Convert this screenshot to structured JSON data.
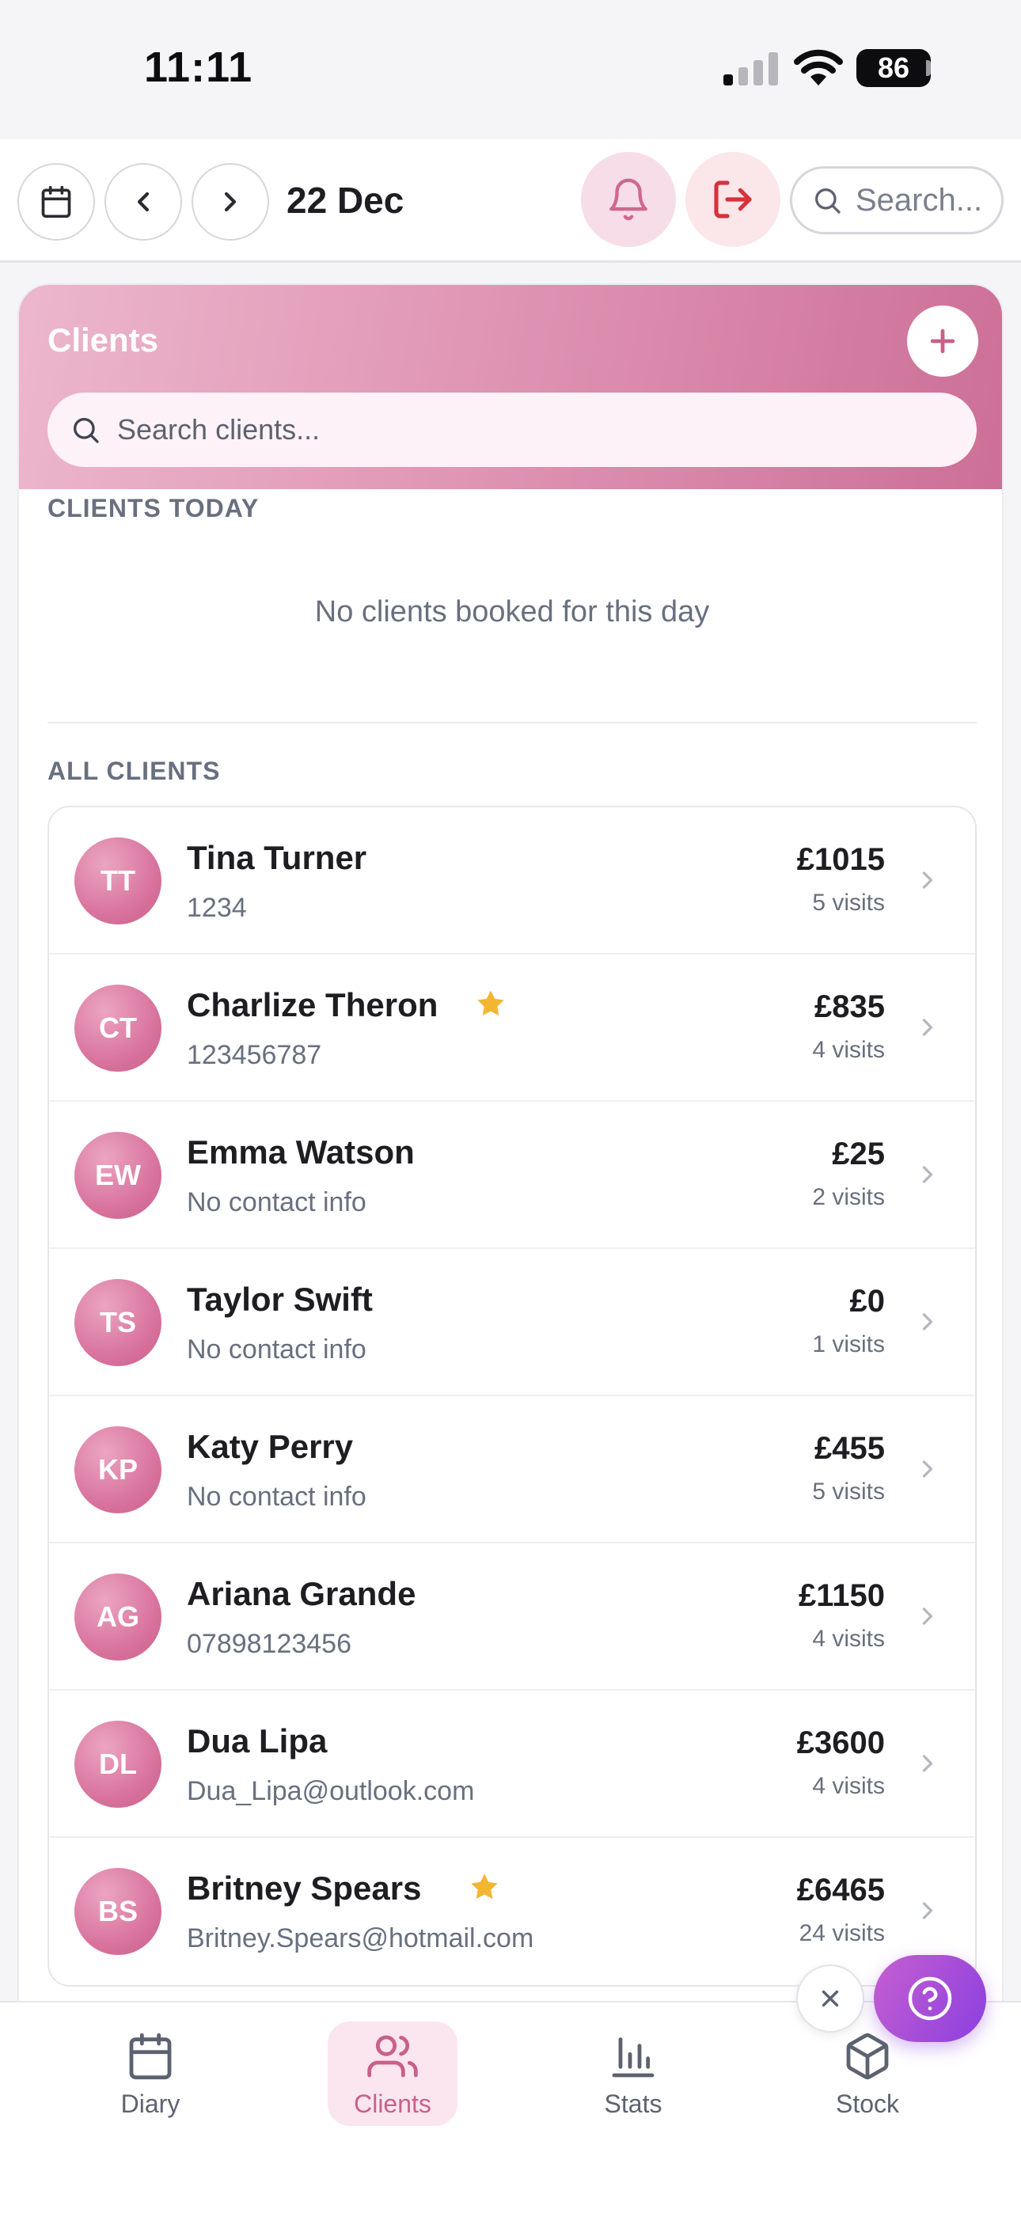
{
  "status_bar": {
    "time": "11:11",
    "battery": "86"
  },
  "topbar": {
    "date": "22 Dec",
    "search_placeholder": "Search..."
  },
  "clients_card": {
    "title": "Clients",
    "search_placeholder": "Search clients...",
    "today_label": "CLIENTS TODAY",
    "empty_message": "No clients booked for this day",
    "all_label": "ALL CLIENTS"
  },
  "clients": [
    {
      "initials": "TT",
      "name": "Tina Turner",
      "sub": "1234",
      "amount": "£1015",
      "visits": "5 visits",
      "starred": false
    },
    {
      "initials": "CT",
      "name": "Charlize Theron",
      "sub": "123456787",
      "amount": "£835",
      "visits": "4 visits",
      "starred": true
    },
    {
      "initials": "EW",
      "name": "Emma Watson",
      "sub": "No contact info",
      "amount": "£25",
      "visits": "2 visits",
      "starred": false
    },
    {
      "initials": "TS",
      "name": "Taylor Swift",
      "sub": "No contact info",
      "amount": "£0",
      "visits": "1 visits",
      "starred": false
    },
    {
      "initials": "KP",
      "name": "Katy Perry",
      "sub": "No contact info",
      "amount": "£455",
      "visits": "5 visits",
      "starred": false
    },
    {
      "initials": "AG",
      "name": "Ariana Grande",
      "sub": "07898123456",
      "amount": "£1150",
      "visits": "4 visits",
      "starred": false
    },
    {
      "initials": "DL",
      "name": "Dua Lipa",
      "sub": "Dua_Lipa@outlook.com",
      "amount": "£3600",
      "visits": "4 visits",
      "starred": false
    },
    {
      "initials": "BS",
      "name": "Britney Spears",
      "sub": "Britney.Spears@hotmail.com",
      "amount": "£6465",
      "visits": "24 visits",
      "starred": true
    }
  ],
  "bottom_nav": {
    "diary": "Diary",
    "clients": "Clients",
    "stats": "Stats",
    "stock": "Stock",
    "active": "clients"
  },
  "colors": {
    "accent": "#c9608b",
    "star": "#f2b632",
    "logout": "#d6323a",
    "help": "#8b3fe0"
  }
}
